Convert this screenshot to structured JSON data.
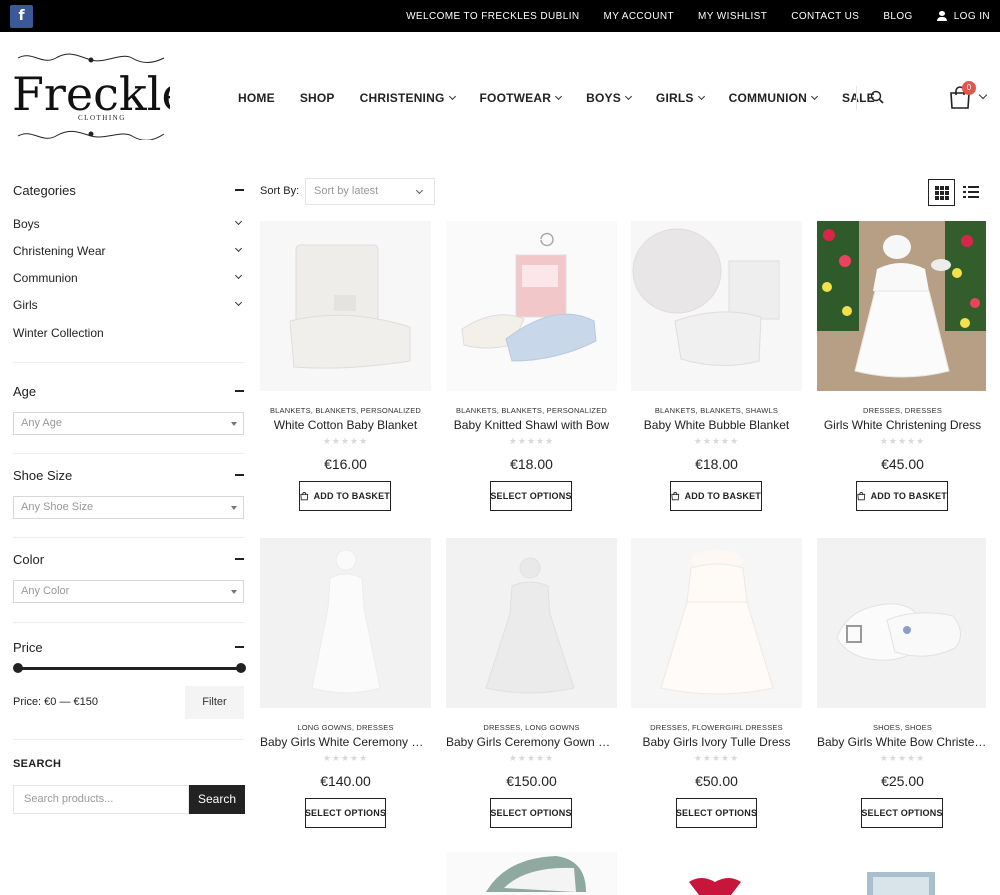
{
  "topbar": {
    "facebook_icon": "f",
    "links": [
      "WELCOME TO FRECKLES DUBLIN",
      "MY ACCOUNT",
      "MY WISHLIST",
      "CONTACT US",
      "BLOG",
      "LOG IN"
    ]
  },
  "brand": {
    "name": "Freckles",
    "sub": "CLOTHING"
  },
  "nav": {
    "items": [
      {
        "label": "HOME",
        "dropdown": false
      },
      {
        "label": "SHOP",
        "dropdown": false
      },
      {
        "label": "CHRISTENING",
        "dropdown": true
      },
      {
        "label": "FOOTWEAR",
        "dropdown": true
      },
      {
        "label": "BOYS",
        "dropdown": true
      },
      {
        "label": "GIRLS",
        "dropdown": true
      },
      {
        "label": "COMMUNION",
        "dropdown": true
      },
      {
        "label": "SALE",
        "dropdown": false
      }
    ],
    "cart_count": "0"
  },
  "sidebar": {
    "categories_title": "Categories",
    "categories": [
      {
        "label": "Boys",
        "dropdown": true
      },
      {
        "label": "Christening Wear",
        "dropdown": true
      },
      {
        "label": "Communion",
        "dropdown": true
      },
      {
        "label": "Girls",
        "dropdown": true
      },
      {
        "label": "Winter Collection",
        "dropdown": false
      }
    ],
    "age": {
      "title": "Age",
      "placeholder": "Any Age"
    },
    "shoe_size": {
      "title": "Shoe Size",
      "placeholder": "Any Shoe Size"
    },
    "color": {
      "title": "Color",
      "placeholder": "Any Color"
    },
    "price": {
      "title": "Price",
      "range_text": "Price: €0 — €150",
      "filter_label": "Filter",
      "min": 0,
      "max": 150
    },
    "search": {
      "title": "SEARCH",
      "placeholder": "Search products...",
      "button": "Search"
    }
  },
  "toolbar": {
    "sort_label": "Sort By:",
    "sort_value": "Sort by latest"
  },
  "products": [
    {
      "cats": "BLANKETS, BLANKETS, PERSONALIZED",
      "title": "White Cotton Baby Blanket",
      "price": "€16.00",
      "button": "ADD TO BASKET",
      "bag": true
    },
    {
      "cats": "BLANKETS, BLANKETS, PERSONALIZED",
      "title": "Baby Knitted Shawl with Bow",
      "price": "€18.00",
      "button": "SELECT OPTIONS",
      "bag": false
    },
    {
      "cats": "BLANKETS, BLANKETS, SHAWLS",
      "title": "Baby White Bubble Blanket",
      "price": "€18.00",
      "button": "ADD TO BASKET",
      "bag": true
    },
    {
      "cats": "DRESSES, DRESSES",
      "title": "Girls White Christening Dress",
      "price": "€45.00",
      "button": "ADD TO BASKET",
      "bag": true
    },
    {
      "cats": "LONG GOWNS, DRESSES",
      "title": "Baby Girls White Ceremony Gown",
      "price": "€140.00",
      "button": "SELECT OPTIONS",
      "bag": false
    },
    {
      "cats": "DRESSES, LONG GOWNS",
      "title": "Baby Girls Ceremony Gown with Bonnet",
      "price": "€150.00",
      "button": "SELECT OPTIONS",
      "bag": false
    },
    {
      "cats": "DRESSES, FLOWERGIRL DRESSES",
      "title": "Baby Girls Ivory Tulle Dress",
      "price": "€50.00",
      "button": "SELECT OPTIONS",
      "bag": false
    },
    {
      "cats": "SHOES, SHOES",
      "title": "Baby Girls White Bow Christening Shoes",
      "price": "€25.00",
      "button": "SELECT OPTIONS",
      "bag": false
    }
  ],
  "rating_stars": "★★★★★"
}
